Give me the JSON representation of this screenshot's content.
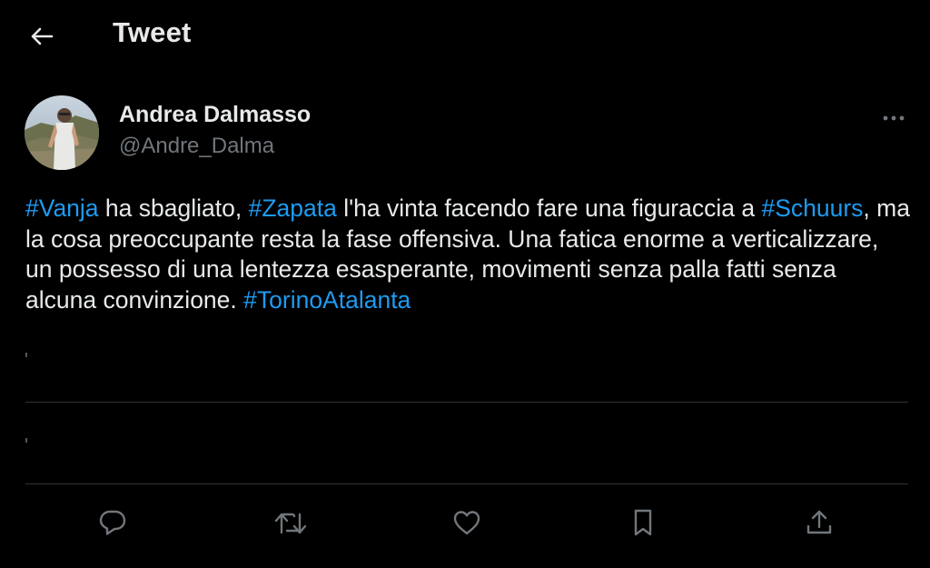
{
  "header": {
    "title": "Tweet",
    "back_icon": "arrow-left-icon"
  },
  "tweet": {
    "author": {
      "name": "Andrea Dalmasso",
      "handle": "@Andre_Dalma",
      "avatar_icon": "profile-photo"
    },
    "more_icon": "more-horizontal-icon",
    "segments": [
      {
        "text": "#Vanja",
        "type": "hashtag"
      },
      {
        "text": " ha sbagliato, ",
        "type": "text"
      },
      {
        "text": "#Zapata",
        "type": "hashtag"
      },
      {
        "text": " l'ha vinta facendo fare una figuraccia a ",
        "type": "text"
      },
      {
        "text": "#Schuurs",
        "type": "hashtag"
      },
      {
        "text": ", ma la cosa preoccupante resta la fase offensiva. Una fatica enorme a verticalizzare, un possesso di una lentezza esasperante, movimenti senza palla fatti senza alcuna convinzione. ",
        "type": "text"
      },
      {
        "text": "#TorinoAtalanta",
        "type": "hashtag"
      }
    ]
  },
  "actions": [
    {
      "name": "reply",
      "icon": "reply-icon"
    },
    {
      "name": "retweet",
      "icon": "retweet-icon"
    },
    {
      "name": "like",
      "icon": "heart-icon"
    },
    {
      "name": "bookmark",
      "icon": "bookmark-icon"
    },
    {
      "name": "share",
      "icon": "share-icon"
    }
  ],
  "colors": {
    "background": "#000000",
    "text": "#e7e9ea",
    "secondary_text": "#71767b",
    "link": "#1d9bf0",
    "divider": "#2f3336"
  }
}
